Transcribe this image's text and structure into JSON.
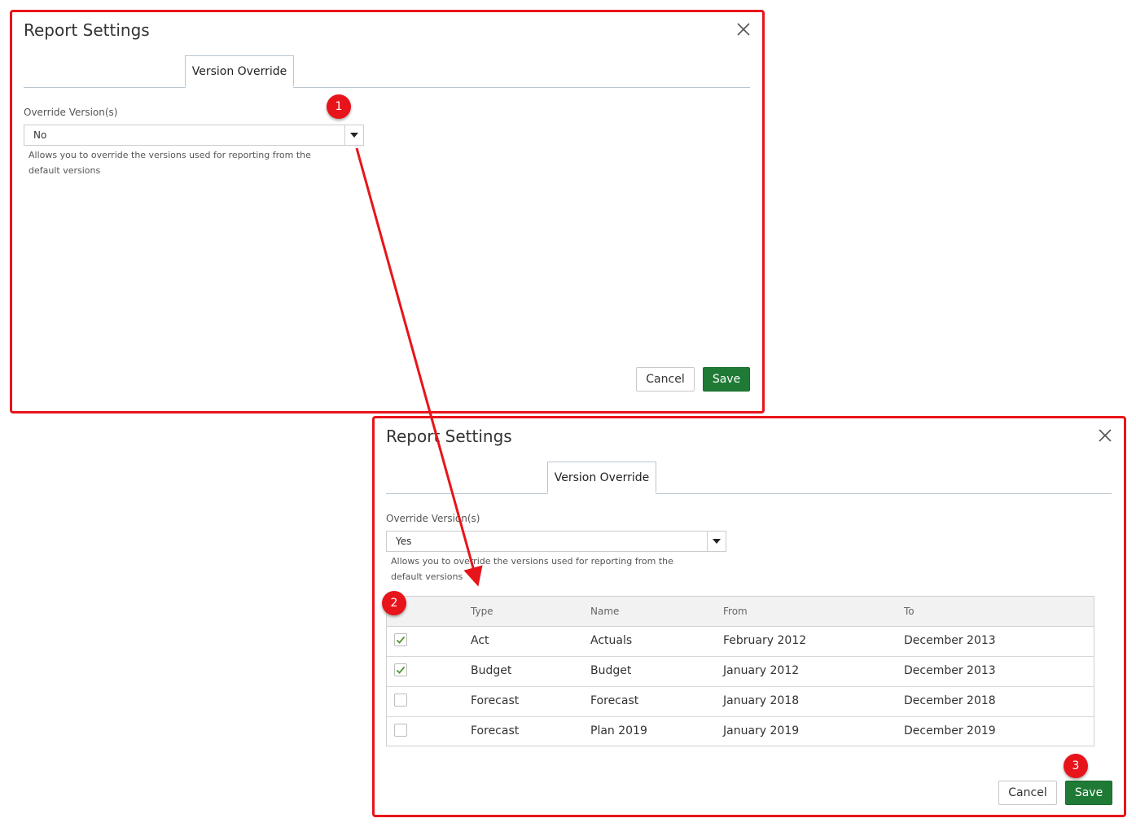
{
  "dialog1": {
    "title": "Report Settings",
    "tab_label": "Version Override",
    "field_label": "Override Version(s)",
    "select_value": "No",
    "help_text": "Allows you to override the versions used for reporting from the default versions",
    "cancel_label": "Cancel",
    "save_label": "Save"
  },
  "dialog2": {
    "title": "Report Settings",
    "tab_label": "Version Override",
    "field_label": "Override Version(s)",
    "select_value": "Yes",
    "help_text": "Allows you to override the versions used for reporting from the default versions",
    "table": {
      "columns": [
        "Type",
        "Name",
        "From",
        "To"
      ],
      "rows": [
        {
          "checked": true,
          "type": "Act",
          "name": "Actuals",
          "from": "February 2012",
          "to": "December 2013"
        },
        {
          "checked": true,
          "type": "Budget",
          "name": "Budget",
          "from": "January 2012",
          "to": "December 2013"
        },
        {
          "checked": false,
          "type": "Forecast",
          "name": "Forecast",
          "from": "January 2018",
          "to": "December 2018"
        },
        {
          "checked": false,
          "type": "Forecast",
          "name": "Plan 2019",
          "from": "January 2019",
          "to": "December 2019"
        }
      ]
    },
    "cancel_label": "Cancel",
    "save_label": "Save"
  },
  "annotations": {
    "badges": [
      "1",
      "2",
      "3"
    ],
    "annotation_color": "#e8141b"
  },
  "colors": {
    "save_button": "#1f7a35",
    "checkmark": "#4a9a2e",
    "tab_border": "#b9c6d0"
  },
  "icons": {
    "close": "close-icon",
    "dropdown": "caret-down-icon",
    "check": "checkmark-icon"
  }
}
